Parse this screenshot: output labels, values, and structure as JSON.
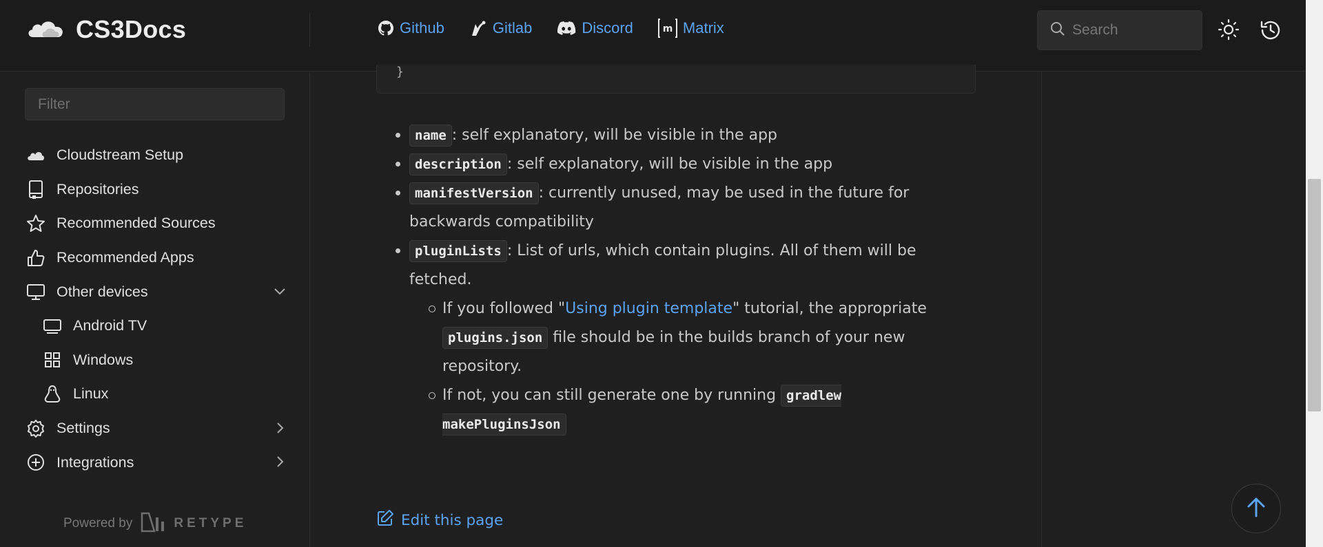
{
  "header": {
    "brand": "CS3Docs",
    "links": [
      {
        "label": "Github",
        "icon": "github-icon"
      },
      {
        "label": "Gitlab",
        "icon": "gitlab-icon"
      },
      {
        "label": "Discord",
        "icon": "discord-icon"
      },
      {
        "label": "Matrix",
        "icon": "matrix-icon"
      }
    ],
    "search_placeholder": "Search"
  },
  "sidebar": {
    "filter_placeholder": "Filter",
    "items": [
      {
        "label": "Cloudstream Setup",
        "icon": "cloud-icon"
      },
      {
        "label": "Repositories",
        "icon": "book-icon"
      },
      {
        "label": "Recommended Sources",
        "icon": "star-icon"
      },
      {
        "label": "Recommended Apps",
        "icon": "thumbs-up-icon"
      },
      {
        "label": "Other devices",
        "icon": "monitor-icon",
        "expanded": true
      },
      {
        "label": "Android TV",
        "icon": "tv-icon"
      },
      {
        "label": "Windows",
        "icon": "windows-icon"
      },
      {
        "label": "Linux",
        "icon": "linux-icon"
      },
      {
        "label": "Settings",
        "icon": "gear-icon"
      },
      {
        "label": "Integrations",
        "icon": "plus-circle-icon"
      }
    ],
    "powered_by": "Powered by",
    "retype": "RETYPE"
  },
  "main": {
    "code_tail": "}",
    "bullets": [
      {
        "code": "name",
        "text": ": self explanatory, will be visible in the app"
      },
      {
        "code": "description",
        "text": ": self explanatory, will be visible in the app"
      },
      {
        "code": "manifestVersion",
        "text": ": currently unused, may be used in the future for backwards compatibility"
      },
      {
        "code": "pluginLists",
        "text": ": List of urls, which contain plugins. All of them will be fetched."
      }
    ],
    "sub": {
      "s1_before": "If you followed \"",
      "s1_link": "Using plugin template",
      "s1_after": "\" tutorial, the appropriate ",
      "s1_code": "plugins.json",
      "s1_end": " file should be in the builds branch of your new repository.",
      "s2_before": "If not, you can still generate one by running ",
      "s2_code": "gradlew makePluginsJson"
    },
    "edit_label": "Edit this page"
  },
  "colors": {
    "background": "#1f1f1f",
    "link": "#5aa3f5",
    "text": "#c9c9c9"
  }
}
